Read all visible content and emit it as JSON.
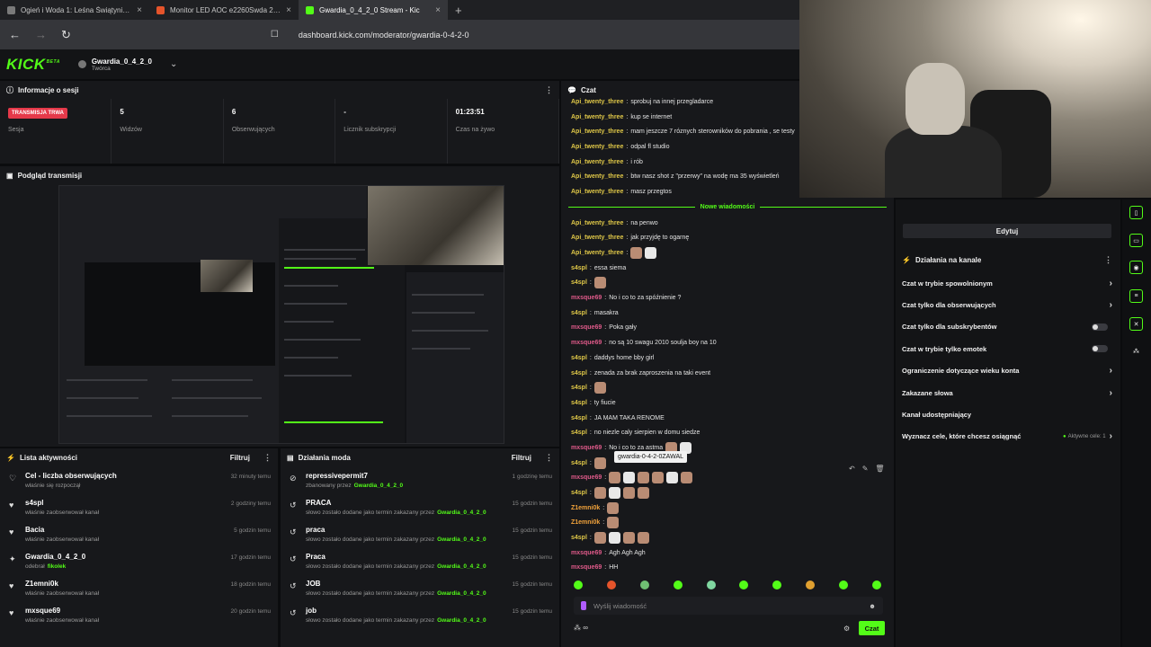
{
  "browser": {
    "tabs": [
      {
        "label": "Ogień i Woda 1: Leśna Świątynia - Gr",
        "color": "#7a7a7a",
        "active": false
      },
      {
        "label": "Monitor LED AOC e2260Swda 21,5 &",
        "color": "#e5542b",
        "active": false
      },
      {
        "label": "Gwardia_0_4_2_0 Stream - Kic",
        "color": "#53fc18",
        "active": true
      }
    ],
    "url": "dashboard.kick.com/moderator/gwardia-0-4-2-0"
  },
  "header": {
    "logo": "KICK",
    "logo_sup": "BETA",
    "channel_name": "Gwardia_0_4_2_0",
    "channel_role": "Twórca"
  },
  "session": {
    "title": "Informacje o sesji",
    "live_badge": "TRANSMISJA TRWA",
    "session_label": "Sesja",
    "stats": [
      {
        "value": "5",
        "label": "Widzów"
      },
      {
        "value": "6",
        "label": "Obserwujących"
      },
      {
        "value": "-",
        "label": "Licznik subskrypcji"
      },
      {
        "value": "01:23:51",
        "label": "Czas na żywo"
      }
    ]
  },
  "preview": {
    "title": "Podgląd transmisji"
  },
  "activity": {
    "title": "Lista aktywności",
    "filter": "Filtruj",
    "items": [
      {
        "icon": "♡",
        "title": "Cel - liczba obserwujących",
        "sub": "właśnie się rozpoczął",
        "time": "32 minuty temu"
      },
      {
        "icon": "♥",
        "title": "s4spl",
        "sub": "właśnie zaobserwował kanał",
        "time": "2 godziny temu"
      },
      {
        "icon": "♥",
        "title": "Bacia",
        "sub": "właśnie zaobserwował kanał",
        "time": "5 godzin temu"
      },
      {
        "icon": "✦",
        "title": "Gwardia_0_4_2_0",
        "sub": "odebrał",
        "sub_green": "fikolek",
        "time": "17 godzin temu"
      },
      {
        "icon": "♥",
        "title": "Z1emni0k",
        "sub": "właśnie zaobserwował kanał",
        "time": "18 godzin temu"
      },
      {
        "icon": "♥",
        "title": "mxsque69",
        "sub": "właśnie zaobserwował kanał",
        "time": "20 godzin temu"
      }
    ]
  },
  "modactions": {
    "title": "Działania moda",
    "filter": "Filtruj",
    "items": [
      {
        "icon": "⊘",
        "title": "repressivepermit7",
        "sub": "zbanowany przez",
        "by": "Gwardia_0_4_2_0",
        "time": "1 godzinę temu"
      },
      {
        "icon": "↺",
        "title": "PRACA",
        "sub": "słowo zostało dodane jako termin zakazany przez",
        "by": "Gwardia_0_4_2_0",
        "time": "15 godzin temu"
      },
      {
        "icon": "↺",
        "title": "praca",
        "sub": "słowo zostało dodane jako termin zakazany przez",
        "by": "Gwardia_0_4_2_0",
        "time": "15 godzin temu"
      },
      {
        "icon": "↺",
        "title": "Praca",
        "sub": "słowo zostało dodane jako termin zakazany przez",
        "by": "Gwardia_0_4_2_0",
        "time": "15 godzin temu"
      },
      {
        "icon": "↺",
        "title": "JOB",
        "sub": "słowo zostało dodane jako termin zakazany przez",
        "by": "Gwardia_0_4_2_0",
        "time": "15 godzin temu"
      },
      {
        "icon": "↺",
        "title": "job",
        "sub": "słowo zostało dodane jako termin zakazany przez",
        "by": "Gwardia_0_4_2_0",
        "time": "15 godzin temu"
      }
    ]
  },
  "chat": {
    "title": "Czat",
    "new_messages": "Nowe wiadomości",
    "before": [
      {
        "user": "Api_twenty_three",
        "cls": "u-b",
        "text": "sprobuj na innej przegladarce"
      },
      {
        "user": "Api_twenty_three",
        "cls": "u-b",
        "text": "kup se internet"
      },
      {
        "user": "Api_twenty_three",
        "cls": "u-b",
        "text": "mam jeszcze 7 róznych sterowników do pobrania , se testy"
      },
      {
        "user": "Api_twenty_three",
        "cls": "u-b",
        "text": "odpal fl studio"
      },
      {
        "user": "Api_twenty_three",
        "cls": "u-b",
        "text": "i rób"
      },
      {
        "user": "Api_twenty_three",
        "cls": "u-b",
        "text": "btw nasz shot z \"przerwy\" na wodę ma 35 wyświetleń"
      },
      {
        "user": "Api_twenty_three",
        "cls": "u-b",
        "text": "masz przegtos"
      }
    ],
    "after": [
      {
        "user": "Api_twenty_three",
        "cls": "u-b",
        "text": "na penwo"
      },
      {
        "user": "Api_twenty_three",
        "cls": "u-b",
        "text": "jak przyjdę to ogarnę"
      },
      {
        "user": "Api_twenty_three",
        "cls": "u-b",
        "text": "",
        "emotes": 2
      },
      {
        "user": "s4spl",
        "cls": "u-b",
        "text": "essa siema"
      },
      {
        "user": "s4spl",
        "cls": "u-b",
        "text": "",
        "emotes": 1
      },
      {
        "user": "mxsque69",
        "cls": "u-c",
        "text": "No i co to za spóźnienie ?"
      },
      {
        "user": "s4spl",
        "cls": "u-b",
        "text": "masakra"
      },
      {
        "user": "mxsque69",
        "cls": "u-c",
        "text": "Poka gały"
      },
      {
        "user": "mxsque69",
        "cls": "u-c",
        "text": "no są 10 swagu 2010 soulja boy na 10"
      },
      {
        "user": "s4spl",
        "cls": "u-b",
        "text": "daddys home bby girl"
      },
      {
        "user": "s4spl",
        "cls": "u-b",
        "text": "zenada za brak zaproszenia na taki event"
      },
      {
        "user": "s4spl",
        "cls": "u-b",
        "text": "",
        "emotes": 1
      },
      {
        "user": "s4spl",
        "cls": "u-b",
        "text": "ty fiucie"
      },
      {
        "user": "s4spl",
        "cls": "u-b",
        "text": "JA MAM TAKA RENOME"
      },
      {
        "user": "s4spl",
        "cls": "u-b",
        "text": "no niezle caly sierpien w domu siedze"
      },
      {
        "user": "mxsque69",
        "cls": "u-c",
        "text": "No i co to za astma",
        "emotes": 2
      },
      {
        "user": "s4spl",
        "cls": "u-b",
        "text": "",
        "emotes": 1
      },
      {
        "user": "mxsque69",
        "cls": "u-c",
        "text": "",
        "emotes": 6
      },
      {
        "user": "s4spl",
        "cls": "u-b",
        "text": "",
        "emotes": 4
      },
      {
        "user": "Z1emni0k",
        "cls": "u-d",
        "text": "",
        "emotes": 1
      },
      {
        "user": "Z1emni0k",
        "cls": "u-d",
        "text": "",
        "emotes": 1
      },
      {
        "user": "s4spl",
        "cls": "u-b",
        "text": "",
        "emotes": 4
      },
      {
        "user": "mxsque69",
        "cls": "u-c",
        "text": "Agh Agh Agh"
      },
      {
        "user": "mxsque69",
        "cls": "u-c",
        "text": "HH"
      }
    ],
    "tooltip": "gwardia-0-4-2-0ZAWAL",
    "input_placeholder": "Wyślij wiadomość",
    "send_label": "Czat"
  },
  "channel": {
    "edit_label": "Edytuj",
    "title": "Działania na kanale",
    "rows": [
      {
        "label": "Czat w trybie spowolnionym",
        "control": "chevron"
      },
      {
        "label": "Czat tylko dla obserwujących",
        "control": "chevron"
      },
      {
        "label": "Czat tylko dla subskrybentów",
        "control": "toggle"
      },
      {
        "label": "Czat w trybie tylko emotek",
        "control": "toggle"
      },
      {
        "label": "Ograniczenie dotyczące wieku konta",
        "control": "chevron"
      },
      {
        "label": "Zakazane słowa",
        "control": "chevron"
      },
      {
        "label": "Kanał udostępniający",
        "control": "none"
      },
      {
        "label": "Wyznacz cele, które chcesz osiągnąć",
        "control": "chevron",
        "extra": "Aktywne cele: 1"
      }
    ]
  },
  "colors": {
    "accent": "#53fc18",
    "live": "#e5394a"
  }
}
